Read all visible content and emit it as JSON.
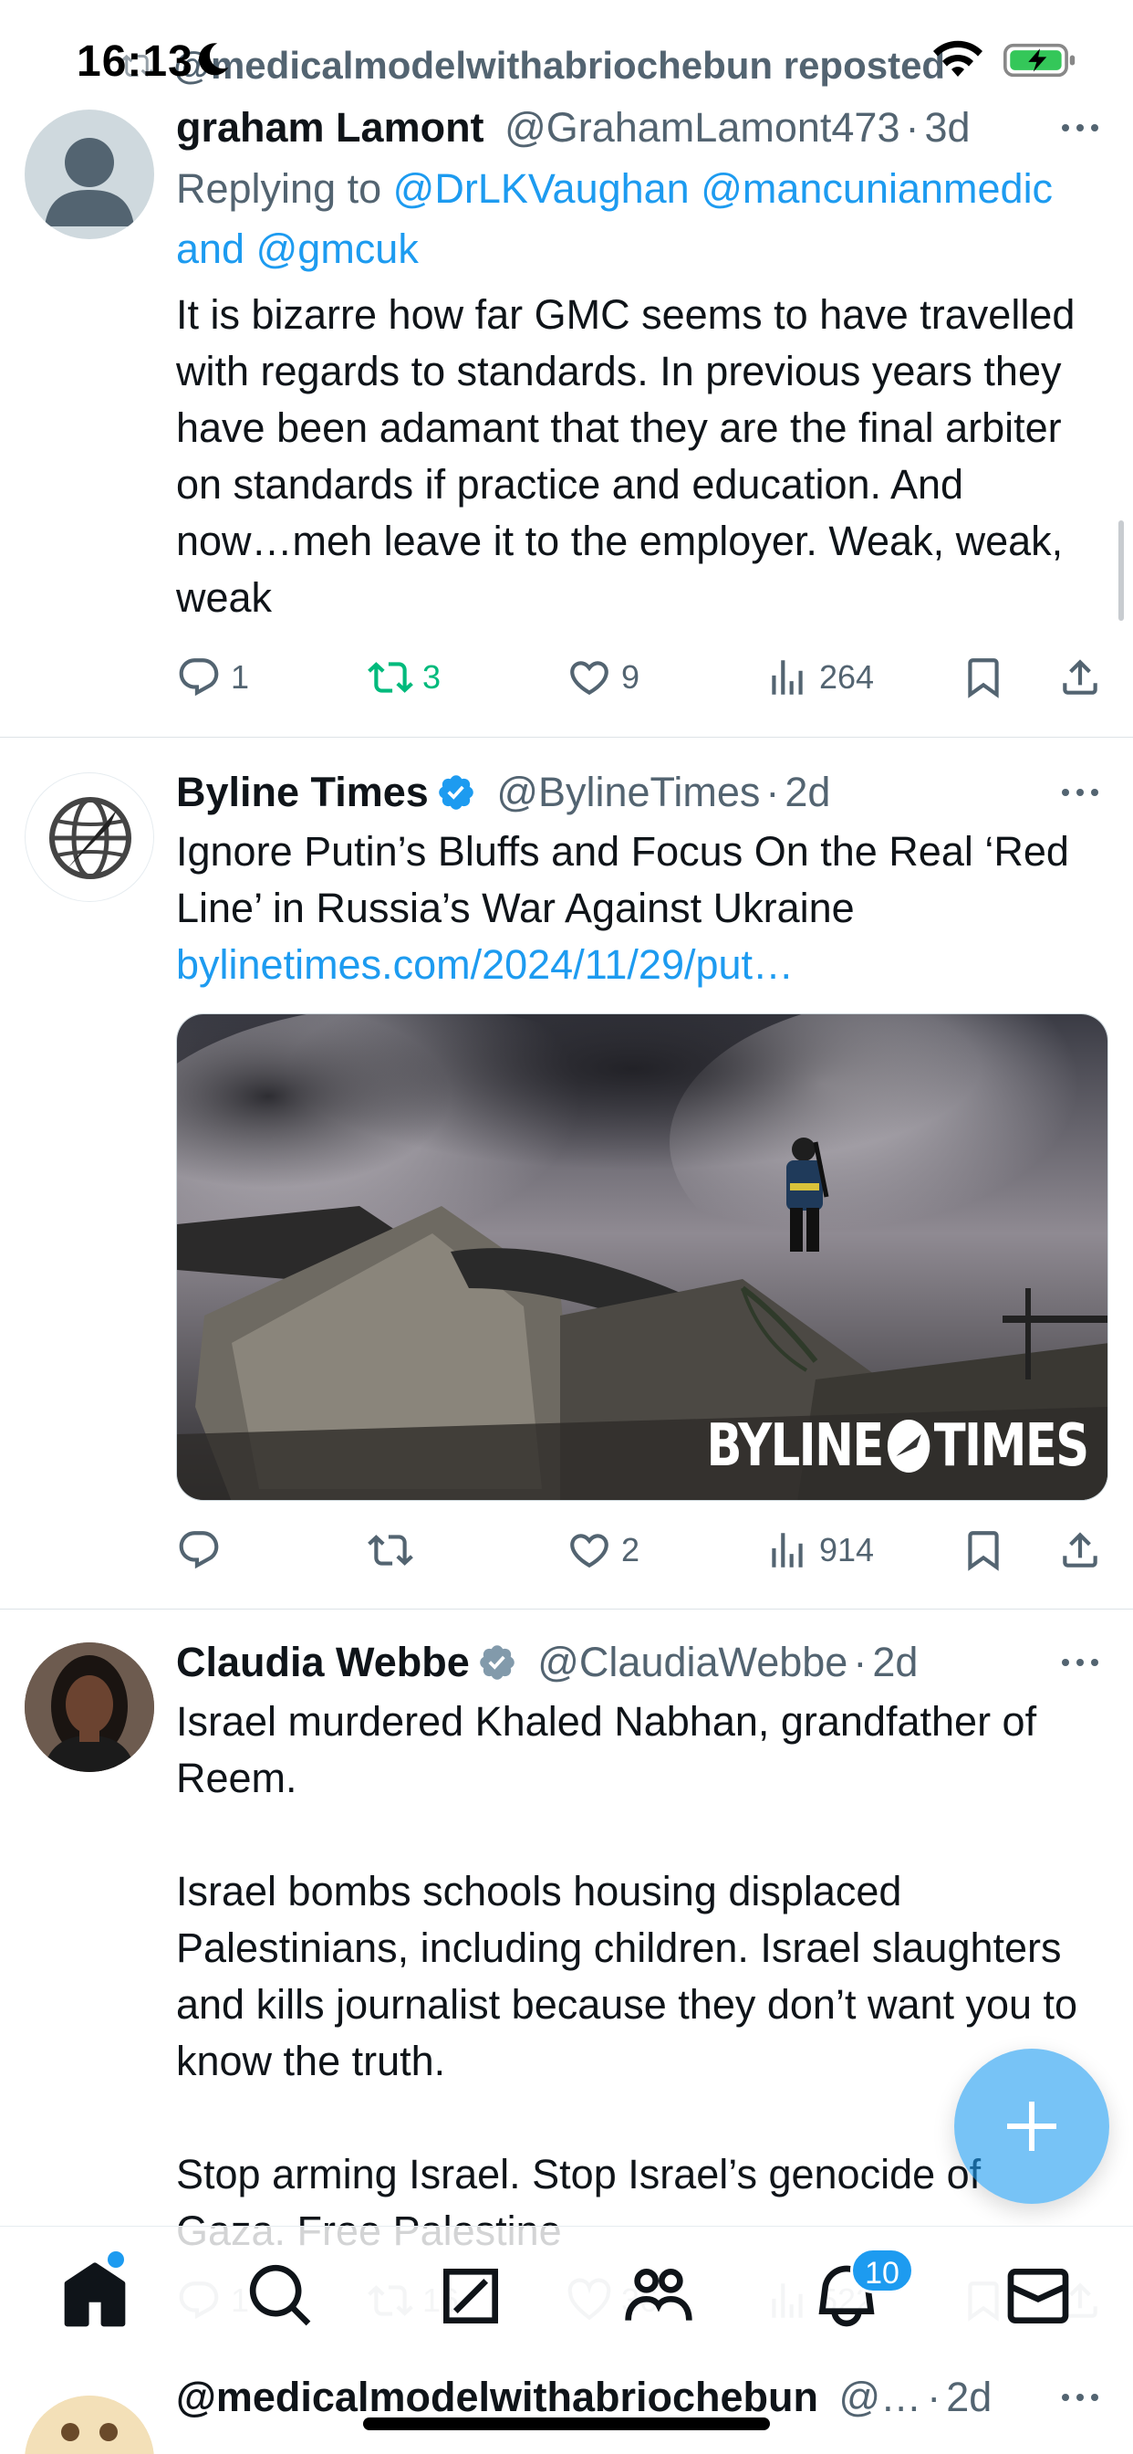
{
  "status_bar": {
    "time": "16:13"
  },
  "repost_header": {
    "text": "@medicalmodelwithabriochebun reposted"
  },
  "tweets": [
    {
      "name": "graham Lamont",
      "handle": "@GrahamLamont473",
      "time": "3d",
      "replying_prefix": "Replying to",
      "replying_mentions": "@DrLKVaughan @mancunianmedic",
      "replying_joiner": "and",
      "replying_last": "@gmcuk",
      "text": "It is bizarre how far GMC seems to have travelled with regards to standards. In previous years they have been adamant that they are the final arbiter on standards if practice and education. And now…meh leave it to the employer. Weak, weak, weak",
      "replies": "1",
      "reposts": "3",
      "likes": "9",
      "views": "264"
    },
    {
      "name": "Byline Times",
      "handle": "@BylineTimes",
      "time": "2d",
      "text": "Ignore Putin’s Bluffs and Focus On the Real ‘Red Line’ in Russia’s War Against Ukraine",
      "link": "bylinetimes.com/2024/11/29/put…",
      "media_watermark": "BYLINE",
      "media_watermark_2": "TIMES",
      "replies": "",
      "reposts": "",
      "likes": "2",
      "views": "914"
    },
    {
      "name": "Claudia Webbe",
      "handle": "@ClaudiaWebbe",
      "time": "2d",
      "text": "Israel murdered Khaled Nabhan, grandfather of Reem.\n\nIsrael bombs schools housing displaced Palestinians, including children. Israel slaughters and kills journalist because they don’t want you to know the truth.\n\nStop arming Israel. Stop Israel’s genocide of Gaza. Free Palestine",
      "replies": "1",
      "reposts": "16",
      "likes": "36",
      "views": "522"
    }
  ],
  "bottom_tweet": {
    "name": "@medicalmodelwithabriochebun",
    "handle": "@…",
    "time": "2d"
  },
  "tab_bar": {
    "notifications_badge": "10"
  },
  "colors": {
    "accent": "#1d9bf0",
    "repost_green": "#00ba7c",
    "text": "#0f1419",
    "secondary": "#536471"
  }
}
